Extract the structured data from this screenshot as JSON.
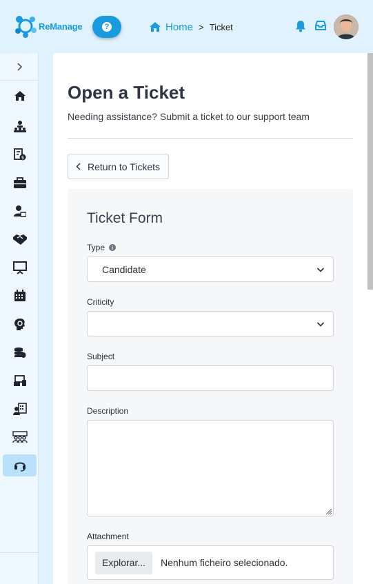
{
  "header": {
    "logo_text": "ReManage",
    "help_label": "?",
    "breadcrumb": {
      "home": "Home",
      "separator": ">",
      "current": "Ticket"
    }
  },
  "page": {
    "title": "Open a Ticket",
    "subtitle": "Needing assistance? Submit a ticket to our support team",
    "return_label": "Return to Tickets"
  },
  "form": {
    "title": "Ticket Form",
    "type_label": "Type",
    "type_value": "Candidate",
    "criticity_label": "Criticity",
    "criticity_value": "",
    "subject_label": "Subject",
    "description_label": "Description",
    "attachment_label": "Attachment",
    "file_button": "Explorar...",
    "file_status": "Nenhum ficheiro selecionado."
  },
  "sidebar": {
    "items": [
      {
        "icon": "home-icon"
      },
      {
        "icon": "users-hierarchy-icon"
      },
      {
        "icon": "payroll-icon"
      },
      {
        "icon": "briefcase-icon"
      },
      {
        "icon": "user-card-icon"
      },
      {
        "icon": "handshake-icon"
      },
      {
        "icon": "presentation-icon"
      },
      {
        "icon": "calendar-icon"
      },
      {
        "icon": "brain-icon"
      },
      {
        "icon": "coins-icon"
      },
      {
        "icon": "devices-icon"
      },
      {
        "icon": "accounting-icon"
      },
      {
        "icon": "team-icon"
      },
      {
        "icon": "headset-icon",
        "active": true
      }
    ]
  },
  "colors": {
    "accent": "#1a9be0",
    "sidebar_bg": "#eef8fe",
    "active_item": "#b9e1fb",
    "header_bg": "#dff2fd"
  }
}
